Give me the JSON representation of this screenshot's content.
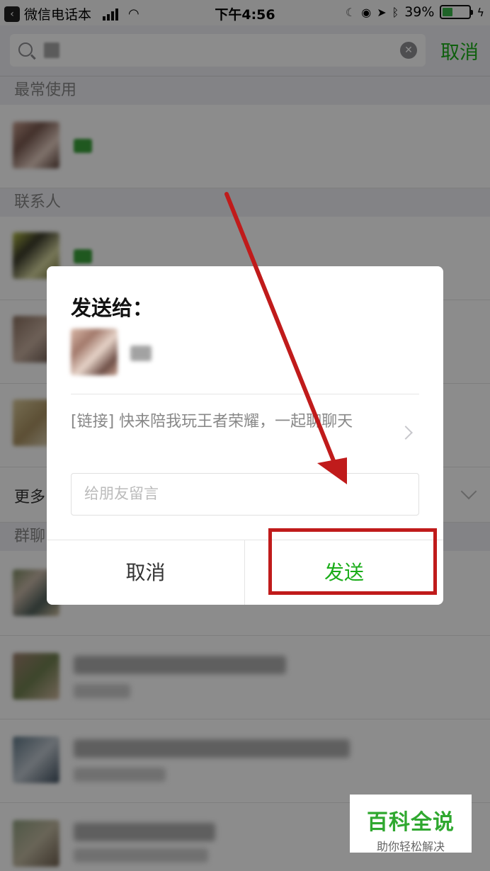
{
  "status_bar": {
    "back_app": "微信电话本",
    "time": "下午4:56",
    "battery_percent": "39%",
    "battery_level": 0.39
  },
  "search": {
    "query": "",
    "cancel_label": "取消"
  },
  "sections": {
    "frequent": "最常使用",
    "contacts": "联系人",
    "more": "更多",
    "groups": "群聊"
  },
  "dialog": {
    "title": "发送给：",
    "link_text": "[链接] 快来陪我玩王者荣耀，一起聊聊天",
    "message_placeholder": "给朋友留言",
    "cancel_label": "取消",
    "send_label": "发送"
  },
  "watermark": {
    "title": "百科全说",
    "subtitle": "助你轻松解决"
  },
  "colors": {
    "accent_green": "#1aad19",
    "annotation_red": "#c01b1b"
  }
}
